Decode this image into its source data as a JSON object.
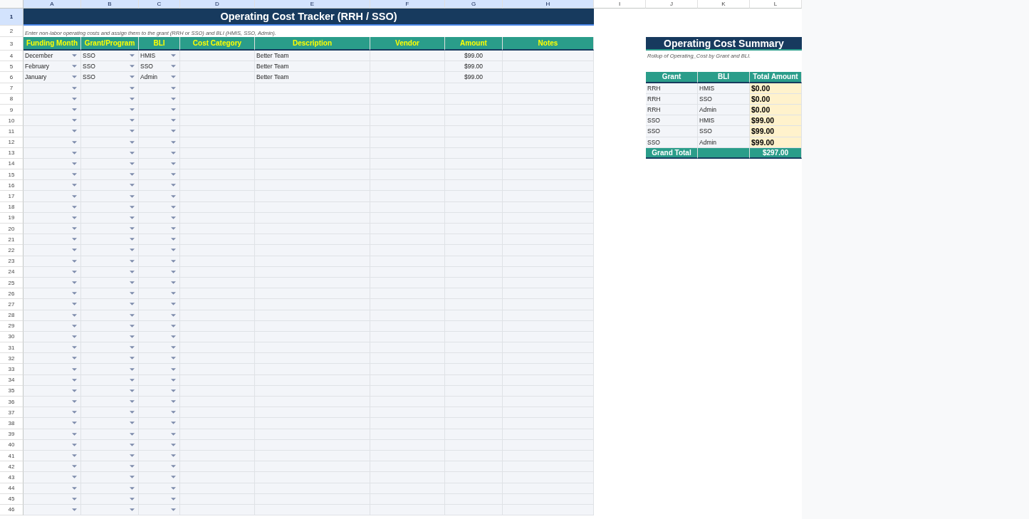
{
  "column_headers": [
    {
      "label": "A",
      "selected": true
    },
    {
      "label": "B",
      "selected": true
    },
    {
      "label": "C",
      "selected": true
    },
    {
      "label": "D",
      "selected": true
    },
    {
      "label": "E",
      "selected": true
    },
    {
      "label": "F",
      "selected": true
    },
    {
      "label": "G",
      "selected": true
    },
    {
      "label": "H",
      "selected": true
    },
    {
      "label": "I",
      "selected": false
    },
    {
      "label": "J",
      "selected": false
    },
    {
      "label": "K",
      "selected": false
    },
    {
      "label": "L",
      "selected": false
    }
  ],
  "row_numbers": [
    {
      "label": "1",
      "selected": true
    },
    {
      "label": "2",
      "selected": false
    },
    {
      "label": "3",
      "selected": false
    },
    {
      "label": "4",
      "selected": false
    },
    {
      "label": "5",
      "selected": false
    },
    {
      "label": "6",
      "selected": false
    },
    {
      "label": "7",
      "selected": false
    },
    {
      "label": "8",
      "selected": false
    },
    {
      "label": "9",
      "selected": false
    },
    {
      "label": "10",
      "selected": false
    },
    {
      "label": "11",
      "selected": false
    },
    {
      "label": "12",
      "selected": false
    },
    {
      "label": "13",
      "selected": false
    },
    {
      "label": "14",
      "selected": false
    },
    {
      "label": "15",
      "selected": false
    },
    {
      "label": "16",
      "selected": false
    },
    {
      "label": "17",
      "selected": false
    },
    {
      "label": "18",
      "selected": false
    },
    {
      "label": "19",
      "selected": false
    },
    {
      "label": "20",
      "selected": false
    },
    {
      "label": "21",
      "selected": false
    },
    {
      "label": "22",
      "selected": false
    },
    {
      "label": "23",
      "selected": false
    },
    {
      "label": "24",
      "selected": false
    },
    {
      "label": "25",
      "selected": false
    },
    {
      "label": "26",
      "selected": false
    },
    {
      "label": "27",
      "selected": false
    },
    {
      "label": "28",
      "selected": false
    },
    {
      "label": "29",
      "selected": false
    },
    {
      "label": "30",
      "selected": false
    },
    {
      "label": "31",
      "selected": false
    },
    {
      "label": "32",
      "selected": false
    },
    {
      "label": "33",
      "selected": false
    },
    {
      "label": "34",
      "selected": false
    },
    {
      "label": "35",
      "selected": false
    },
    {
      "label": "36",
      "selected": false
    },
    {
      "label": "37",
      "selected": false
    },
    {
      "label": "38",
      "selected": false
    },
    {
      "label": "39",
      "selected": false
    },
    {
      "label": "40",
      "selected": false
    },
    {
      "label": "41",
      "selected": false
    },
    {
      "label": "42",
      "selected": false
    },
    {
      "label": "43",
      "selected": false
    },
    {
      "label": "44",
      "selected": false
    },
    {
      "label": "45",
      "selected": false
    },
    {
      "label": "46",
      "selected": false
    }
  ],
  "title": "Operating Cost Tracker (RRH / SSO)",
  "instructions": "Enter non-labor operating costs and assign them to the grant (RRH or SSO) and BLI (HMIS, SSO, Admin).",
  "table": {
    "columns": [
      {
        "label": "Funding Month",
        "kind": "dropdown"
      },
      {
        "label": "Grant/Program",
        "kind": "dropdown"
      },
      {
        "label": "BLI",
        "kind": "dropdown"
      },
      {
        "label": "Cost Category",
        "kind": "text"
      },
      {
        "label": "Description",
        "kind": "text"
      },
      {
        "label": "Vendor",
        "kind": "text"
      },
      {
        "label": "Amount",
        "kind": "amount"
      },
      {
        "label": "Notes",
        "kind": "text"
      }
    ],
    "rows": [
      [
        "December",
        "SSO",
        "HMIS",
        "",
        "Better Team",
        "",
        "$99.00",
        ""
      ],
      [
        "February",
        "SSO",
        "SSO",
        "",
        "Better Team",
        "",
        "$99.00",
        ""
      ],
      [
        "January",
        "SSO",
        "Admin",
        "",
        "Better Team",
        "",
        "$99.00",
        ""
      ]
    ]
  },
  "summary": {
    "title": "Operating Cost Summary",
    "subtitle": "Rollup of Operating_Cost by Grant and BLI.",
    "columns": [
      "Grant",
      "BLI",
      "Total Amount"
    ],
    "rows": [
      [
        "RRH",
        "HMIS",
        "$0.00"
      ],
      [
        "RRH",
        "SSO",
        "$0.00"
      ],
      [
        "RRH",
        "Admin",
        "$0.00"
      ],
      [
        "SSO",
        "HMIS",
        "$99.00"
      ],
      [
        "SSO",
        "SSO",
        "$99.00"
      ],
      [
        "SSO",
        "Admin",
        "$99.00"
      ]
    ],
    "total": {
      "label": "Grand Total",
      "value": "$297.00"
    }
  }
}
